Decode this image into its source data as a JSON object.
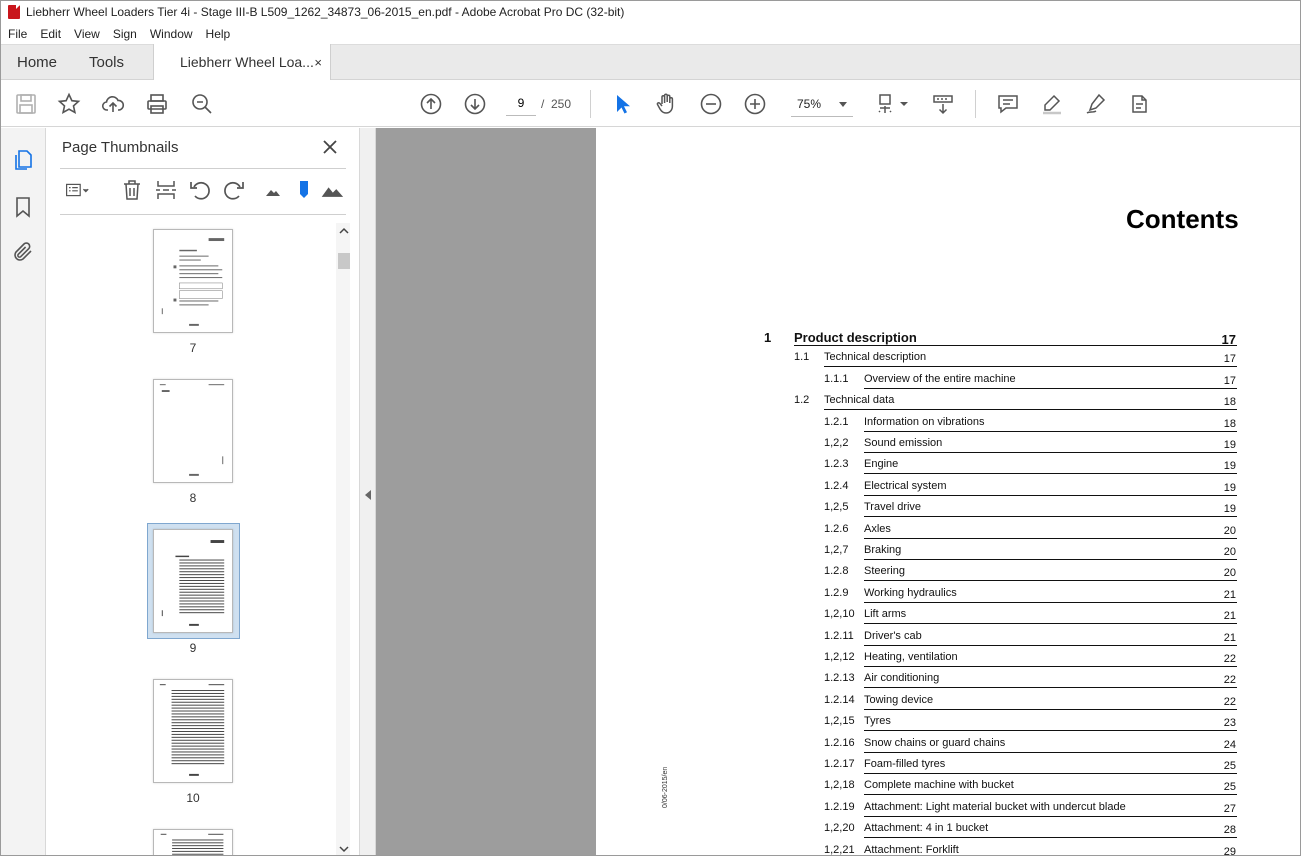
{
  "window": {
    "title": "Liebherr Wheel Loaders Tier 4i - Stage III-B L509_1262_34873_06-2015_en.pdf - Adobe Acrobat Pro DC (32-bit)"
  },
  "menu": [
    "File",
    "Edit",
    "View",
    "Sign",
    "Window",
    "Help"
  ],
  "tabs": {
    "home": "Home",
    "tools": "Tools",
    "doc": "Liebherr Wheel Loa...",
    "close": "×"
  },
  "toolbar": {
    "page_current": "9",
    "page_sep": "/",
    "page_total": "250",
    "zoom": "75%"
  },
  "icons": {
    "save": "save-icon",
    "star": "star-icon",
    "upload": "cloud-upload-icon",
    "print": "print-icon",
    "find": "search-icon",
    "prev": "arrow-up-icon",
    "next": "arrow-down-icon",
    "select": "cursor-icon",
    "hand": "hand-icon",
    "zoom_out": "zoom-out-icon",
    "zoom_in": "zoom-in-icon"
  },
  "panel": {
    "title": "Page Thumbnails",
    "thumbs": [
      "7",
      "8",
      "9",
      "10"
    ]
  },
  "document": {
    "heading": "Contents",
    "side_note": "0/06-2015/en",
    "toc": [
      {
        "level": 1,
        "num": "1",
        "title": "Product description",
        "page": "17"
      },
      {
        "level": 2,
        "num": "1.1",
        "title": "Technical description",
        "page": "17"
      },
      {
        "level": 3,
        "num": "1.1.1",
        "title": "Overview of the entire machine",
        "page": "17"
      },
      {
        "level": 2,
        "num": "1.2",
        "title": "Technical data",
        "page": "18"
      },
      {
        "level": 3,
        "num": "1.2.1",
        "title": "Information on vibrations",
        "page": "18"
      },
      {
        "level": 3,
        "num": "1,2,2",
        "title": "Sound emission",
        "page": "19"
      },
      {
        "level": 3,
        "num": "1.2.3",
        "title": "Engine",
        "page": "19"
      },
      {
        "level": 3,
        "num": "1.2.4",
        "title": "Electrical system",
        "page": "19"
      },
      {
        "level": 3,
        "num": "1,2,5",
        "title": "Travel drive",
        "page": "19"
      },
      {
        "level": 3,
        "num": "1.2.6",
        "title": "Axles",
        "page": "20"
      },
      {
        "level": 3,
        "num": "1,2,7",
        "title": "Braking",
        "page": "20"
      },
      {
        "level": 3,
        "num": "1.2.8",
        "title": "Steering",
        "page": "20"
      },
      {
        "level": 3,
        "num": "1.2.9",
        "title": "Working hydraulics",
        "page": "21"
      },
      {
        "level": 3,
        "num": "1,2,10",
        "title": "Lift arms",
        "page": "21"
      },
      {
        "level": 3,
        "num": "1.2.11",
        "title": "Driver's cab",
        "page": "21"
      },
      {
        "level": 3,
        "num": "1,2,12",
        "title": "Heating, ventilation",
        "page": "22"
      },
      {
        "level": 3,
        "num": "1.2.13",
        "title": "Air conditioning",
        "page": "22"
      },
      {
        "level": 3,
        "num": "1.2.14",
        "title": "Towing device",
        "page": "22"
      },
      {
        "level": 3,
        "num": "1,2,15",
        "title": "Tyres",
        "page": "23"
      },
      {
        "level": 3,
        "num": "1.2.16",
        "title": "Snow chains or guard chains",
        "page": "24"
      },
      {
        "level": 3,
        "num": "1.2.17",
        "title": "Foam-filled tyres",
        "page": "25"
      },
      {
        "level": 3,
        "num": "1,2,18",
        "title": "Complete machine with bucket",
        "page": "25"
      },
      {
        "level": 3,
        "num": "1.2.19",
        "title": "Attachment: Light material bucket with undercut blade",
        "page": "27"
      },
      {
        "level": 3,
        "num": "1,2,20",
        "title": "Attachment: 4 in 1 bucket",
        "page": "28"
      },
      {
        "level": 3,
        "num": "1,2,21",
        "title": "Attachment: Forklift",
        "page": "29"
      }
    ]
  }
}
